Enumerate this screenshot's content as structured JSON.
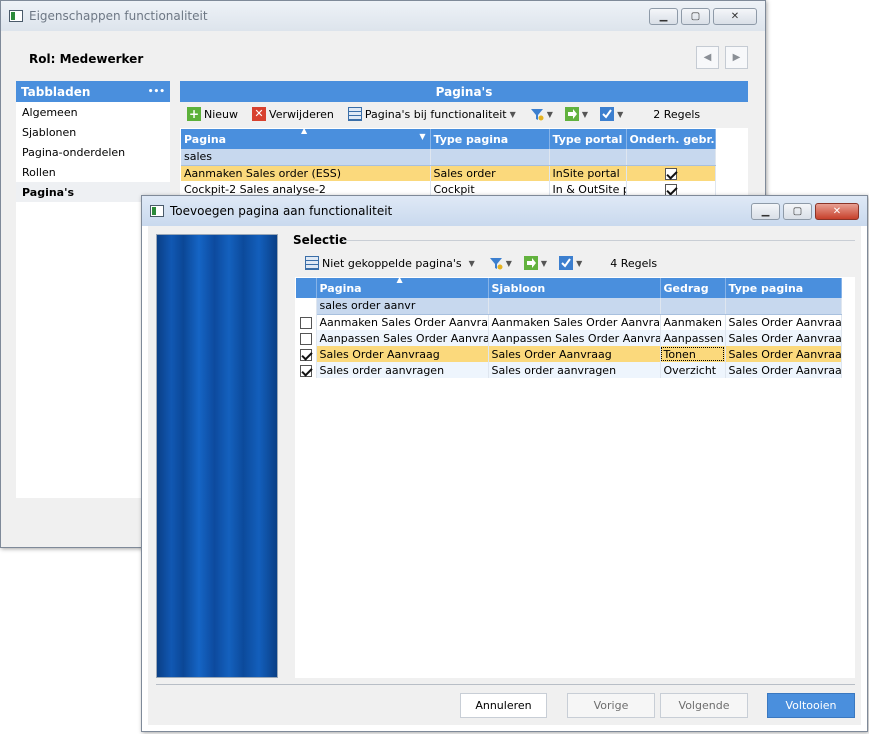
{
  "back_window": {
    "title": "Eigenschappen functionaliteit",
    "role_label": "Rol: Medewerker",
    "tabs_header": "Tabbladen",
    "tabs_menu": "•••",
    "tabs": [
      "Algemeen",
      "Sjablonen",
      "Pagina-onderdelen",
      "Rollen",
      "Pagina's"
    ],
    "pages_header": "Pagina's",
    "toolbar": {
      "new_label": "Nieuw",
      "delete_label": "Verwijderen",
      "pages_label": "Pagina's bij functionaliteit",
      "count_label": "2 Regels"
    },
    "columns": [
      "Pagina",
      "Type pagina",
      "Type portal",
      "Onderh. gebr."
    ],
    "filter_value": "sales",
    "rows": [
      {
        "pagina": "Aanmaken Sales order (ESS)",
        "type": "Sales order",
        "portal": "InSite portal",
        "checked": true
      },
      {
        "pagina": "Cockpit-2 Sales analyse-2",
        "type": "Cockpit",
        "portal": "In & OutSite po",
        "checked": true
      }
    ]
  },
  "front_window": {
    "title": "Toevoegen pagina aan functionaliteit",
    "section_title": "Selectie",
    "toolbar": {
      "unlinked_label": "Niet gekoppelde pagina's",
      "count_label": "4 Regels"
    },
    "columns": [
      "Pagina",
      "Sjabloon",
      "Gedrag",
      "Type pagina"
    ],
    "filter_value": "sales order aanvr",
    "rows": [
      {
        "checked": false,
        "pagina": "Aanmaken Sales Order Aanvraag",
        "sjabloon": "Aanmaken Sales Order Aanvraag",
        "gedrag": "Aanmaken",
        "type": "Sales Order Aanvraag"
      },
      {
        "checked": false,
        "pagina": "Aanpassen Sales Order Aanvraag",
        "sjabloon": "Aanpassen Sales Order Aanvraag",
        "gedrag": "Aanpassen",
        "type": "Sales Order Aanvraag"
      },
      {
        "checked": true,
        "pagina": "Sales Order Aanvraag",
        "sjabloon": "Sales Order Aanvraag",
        "gedrag": "Tonen",
        "type": "Sales Order Aanvraag"
      },
      {
        "checked": true,
        "pagina": "Sales order aanvragen",
        "sjabloon": "Sales order aanvragen",
        "gedrag": "Overzicht",
        "type": "Sales Order Aanvraag"
      }
    ],
    "buttons": {
      "cancel": "Annuleren",
      "previous": "Vorige",
      "next": "Volgende",
      "finish": "Voltooien"
    }
  },
  "colors": {
    "accent_blue": "#4a8fdd",
    "selected_row": "#fbd97c",
    "filter_row": "#c7d8ee"
  }
}
